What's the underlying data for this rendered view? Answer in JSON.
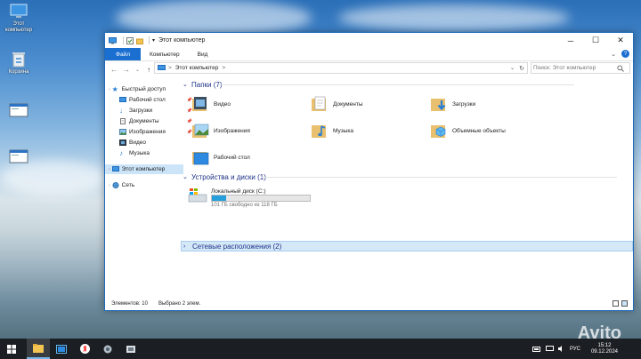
{
  "desktop": {
    "icons": [
      {
        "label": "Этот компьютер",
        "icon": "computer-icon"
      },
      {
        "label": "Корзина",
        "icon": "recycle-bin-icon"
      },
      {
        "label": "",
        "icon": "window-thumbnail-icon"
      },
      {
        "label": "",
        "icon": "window-thumbnail-icon"
      }
    ],
    "watermark": "Avito"
  },
  "window": {
    "title": "Этот компьютер",
    "quick_access_icons": [
      "computer-icon",
      "properties-icon",
      "new-folder-icon",
      "customize-arrow-icon"
    ],
    "controls": {
      "minimize": "─",
      "maximize": "☐",
      "close": "✕"
    },
    "ribbon_tabs": [
      "Файл",
      "Компьютер",
      "Вид"
    ],
    "ribbon_collapse": "⌄",
    "help": "?",
    "nav": {
      "back": "←",
      "forward": "→",
      "recent": "⌄",
      "up": "↑"
    },
    "address": {
      "path": "Этот компьютер",
      "separator": ">",
      "dropdown": "⌄",
      "refresh": "↻"
    },
    "search_placeholder": "Поиск: Этот компьютер",
    "nav_pane": [
      {
        "label": "Быстрый доступ",
        "icon": "star-icon",
        "pinned": false
      },
      {
        "label": "Рабочий стол",
        "icon": "desktop-icon",
        "pinned": true
      },
      {
        "label": "Загрузки",
        "icon": "download-icon",
        "pinned": true
      },
      {
        "label": "Документы",
        "icon": "documents-icon",
        "pinned": true
      },
      {
        "label": "Изображения",
        "icon": "pictures-icon",
        "pinned": true
      },
      {
        "label": "Видео",
        "icon": "video-icon",
        "pinned": false
      },
      {
        "label": "Музыка",
        "icon": "music-icon",
        "pinned": false
      },
      {
        "label": "Этот компьютер",
        "icon": "computer-icon",
        "pinned": false,
        "selected": true
      },
      {
        "label": "Сеть",
        "icon": "network-icon",
        "pinned": false
      }
    ],
    "pin_glyph": "📌",
    "sections": {
      "folders": {
        "title": "Папки (7)",
        "chevron": "⌄"
      },
      "drives": {
        "title": "Устройства и диски (1)",
        "chevron": "⌄"
      },
      "network": {
        "title": "Сетевые расположения (2)",
        "chevron": "›"
      }
    },
    "folders": [
      {
        "label": "Видео",
        "icon": "video-folder-icon"
      },
      {
        "label": "Документы",
        "icon": "documents-folder-icon"
      },
      {
        "label": "Загрузки",
        "icon": "downloads-folder-icon"
      },
      {
        "label": "Изображения",
        "icon": "pictures-folder-icon"
      },
      {
        "label": "Музыка",
        "icon": "music-folder-icon"
      },
      {
        "label": "Объемные объекты",
        "icon": "3d-objects-folder-icon"
      },
      {
        "label": "Рабочий стол",
        "icon": "desktop-folder-icon"
      }
    ],
    "drive": {
      "label": "Локальный диск (C:)",
      "free_text": "101 ГБ свободно из 118 ГБ",
      "used_fraction": 0.144
    },
    "status": {
      "items": "Элементов: 10",
      "selected": "Выбрано 2 элем."
    }
  },
  "taskbar": {
    "apps": [
      "windows-start-icon",
      "file-explorer-icon",
      "task-view-icon",
      "yandex-browser-icon",
      "app-icon",
      "app-icon"
    ],
    "tray": {
      "language": "РУС",
      "time": "15:12",
      "date": "09.12.2024"
    }
  },
  "colors": {
    "accent": "#1a6fd0",
    "selection": "#cce4f7",
    "heading": "#1e3287",
    "taskbar": "#1b1e22"
  }
}
